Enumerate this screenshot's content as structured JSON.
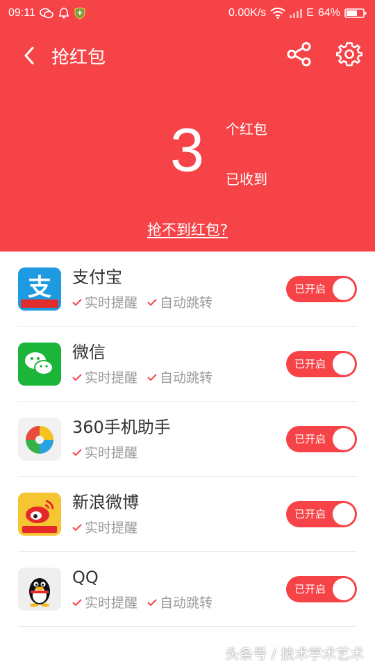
{
  "status": {
    "time": "09:11",
    "network_speed": "0.00K/s",
    "network_type": "E",
    "battery": "64%"
  },
  "header": {
    "title": "抢红包",
    "count": "3",
    "unit": "个红包",
    "label": "已收到",
    "link": "抢不到红包?"
  },
  "apps": [
    {
      "name": "支付宝",
      "tags": [
        "实时提醒",
        "自动跳转"
      ],
      "toggle": "已开启",
      "icon": "alipay-icon",
      "icon_badge": "福到财到"
    },
    {
      "name": "微信",
      "tags": [
        "实时提醒",
        "自动跳转"
      ],
      "toggle": "已开启",
      "icon": "wechat-icon"
    },
    {
      "name": "360手机助手",
      "tags": [
        "实时提醒"
      ],
      "toggle": "已开启",
      "icon": "360-assistant-icon"
    },
    {
      "name": "新浪微博",
      "tags": [
        "实时提醒"
      ],
      "toggle": "已开启",
      "icon": "weibo-icon",
      "icon_badge": "让红包飞"
    },
    {
      "name": "QQ",
      "tags": [
        "实时提醒",
        "自动跳转"
      ],
      "toggle": "已开启",
      "icon": "qq-icon"
    }
  ],
  "watermark": "头条号 / 技术学术艺术",
  "colors": {
    "accent": "#f64347"
  }
}
